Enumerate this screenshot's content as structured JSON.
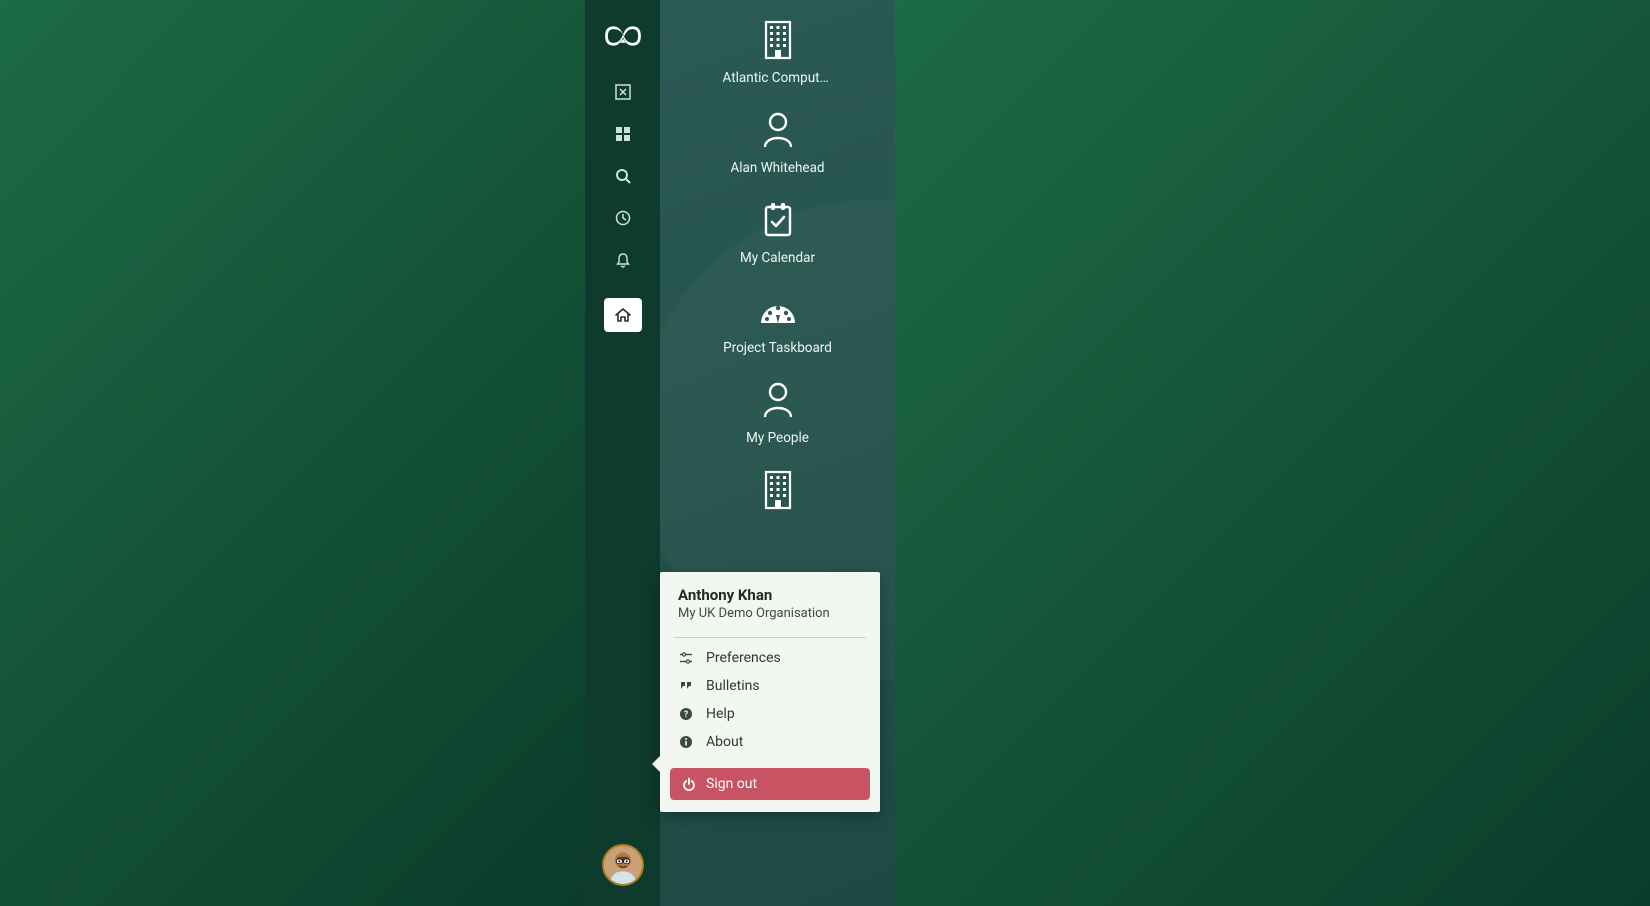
{
  "sidebar": {
    "icons": [
      "close",
      "grid",
      "search",
      "clock",
      "bell"
    ]
  },
  "favorites": {
    "items": [
      {
        "icon": "building",
        "label": "Atlantic Computers"
      },
      {
        "icon": "user",
        "label": "Alan Whitehead"
      },
      {
        "icon": "calendar",
        "label": "My Calendar"
      },
      {
        "icon": "dashboard",
        "label": "Project Taskboard"
      },
      {
        "icon": "user",
        "label": "My People"
      },
      {
        "icon": "building",
        "label": ""
      }
    ]
  },
  "popup": {
    "user_name": "Anthony Khan",
    "org_name": "My UK Demo Organisation",
    "menu": {
      "preferences": "Preferences",
      "bulletins": "Bulletins",
      "help": "Help",
      "about": "About"
    },
    "signout_label": "Sign out"
  },
  "colors": {
    "accent_red": "#c85463",
    "sidebar_bg": "#0f3a2e"
  }
}
